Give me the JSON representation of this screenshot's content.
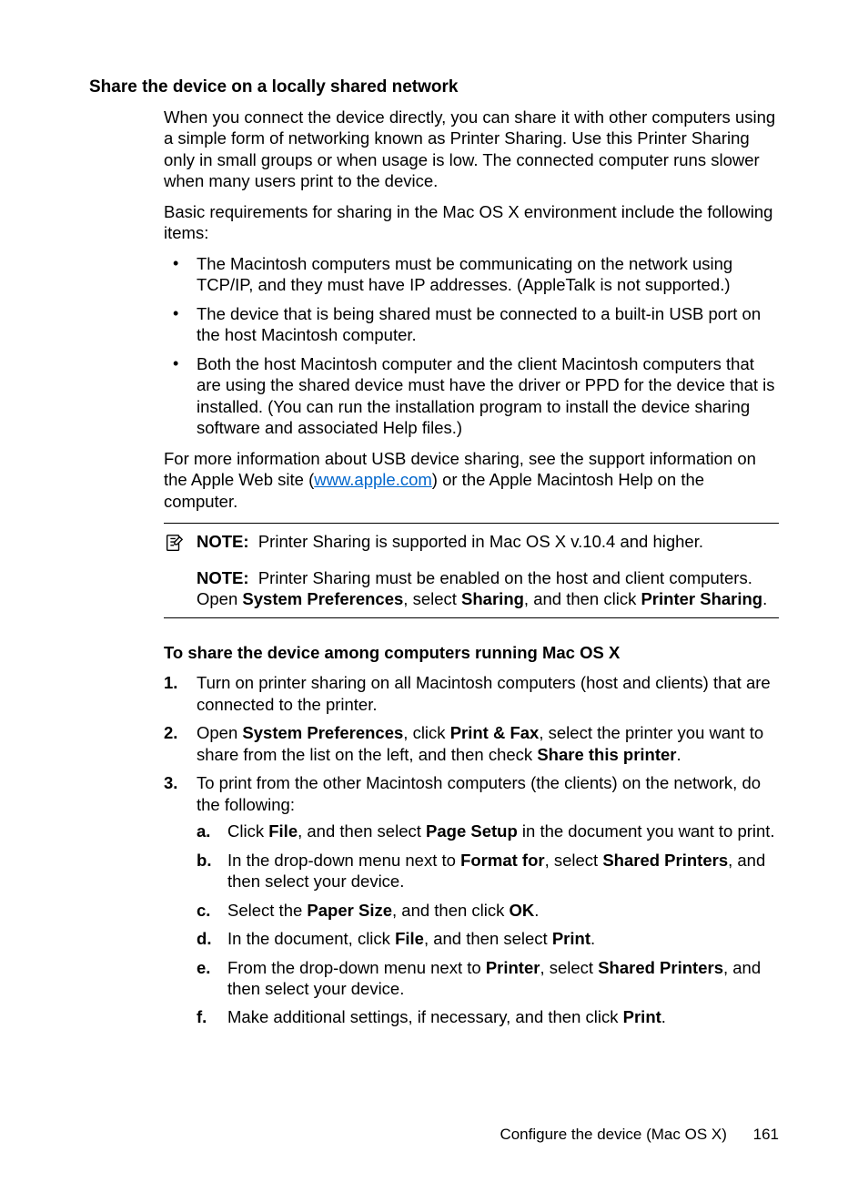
{
  "heading": "Share the device on a locally shared network",
  "intro1": "When you connect the device directly, you can share it with other computers using a simple form of networking known as Printer Sharing. Use this Printer Sharing only in small groups or when usage is low. The connected computer runs slower when many users print to the device.",
  "intro2": "Basic requirements for sharing in the Mac OS X environment include the following items:",
  "bullets": [
    "The Macintosh computers must be communicating on the network using TCP/IP, and they must have IP addresses. (AppleTalk is not supported.)",
    "The device that is being shared must be connected to a built-in USB port on the host Macintosh computer.",
    "Both the host Macintosh computer and the client Macintosh computers that are using the shared device must have the driver or PPD for the device that is installed. (You can run the installation program to install the device sharing software and associated Help files.)"
  ],
  "moreinfo": {
    "pre": "For more information about USB device sharing, see the support information on the Apple Web site (",
    "link_text": "www.apple.com",
    "post": ") or the Apple Macintosh Help on the computer."
  },
  "note1": {
    "label": "NOTE:",
    "text": "Printer Sharing is supported in Mac OS X v.10.4 and higher."
  },
  "note2": {
    "label": "NOTE:",
    "pre": "Printer Sharing must be enabled on the host and client computers. Open ",
    "bold1": "System Preferences",
    "mid1": ", select ",
    "bold2": "Sharing",
    "mid2": ", and then click ",
    "bold3": "Printer Sharing",
    "post": "."
  },
  "subheading": "To share the device among computers running Mac OS X",
  "step1": "Turn on printer sharing on all Macintosh computers (host and clients) that are connected to the printer.",
  "step2": {
    "pre": "Open ",
    "b1": "System Preferences",
    "m1": ", click ",
    "b2": "Print & Fax",
    "m2": ", select the printer you want to share from the list on the left, and then check ",
    "b3": "Share this printer",
    "post": "."
  },
  "step3": "To print from the other Macintosh computers (the clients) on the network, do the following:",
  "alpha": {
    "a": {
      "marker": "a",
      "pre": "Click ",
      "b1": "File",
      "m1": ", and then select ",
      "b2": "Page Setup",
      "post": " in the document you want to print."
    },
    "b": {
      "marker": "b",
      "pre": "In the drop-down menu next to ",
      "b1": "Format for",
      "m1": ", select ",
      "b2": "Shared Printers",
      "post": ", and then select your device."
    },
    "c": {
      "marker": "c",
      "pre": "Select the ",
      "b1": "Paper Size",
      "m1": ", and then click ",
      "b2": "OK",
      "post": "."
    },
    "d": {
      "marker": "d",
      "pre": "In the document, click ",
      "b1": "File",
      "m1": ", and then select ",
      "b2": "Print",
      "post": "."
    },
    "e": {
      "marker": "e",
      "pre": "From the drop-down menu next to ",
      "b1": "Printer",
      "m1": ", select ",
      "b2": "Shared Printers",
      "post": ", and then select your device."
    },
    "f": {
      "marker": "f",
      "pre": "Make additional settings, if necessary, and then click ",
      "b1": "Print",
      "post": "."
    }
  },
  "footer": {
    "section": "Configure the device (Mac OS X)",
    "page": "161"
  }
}
